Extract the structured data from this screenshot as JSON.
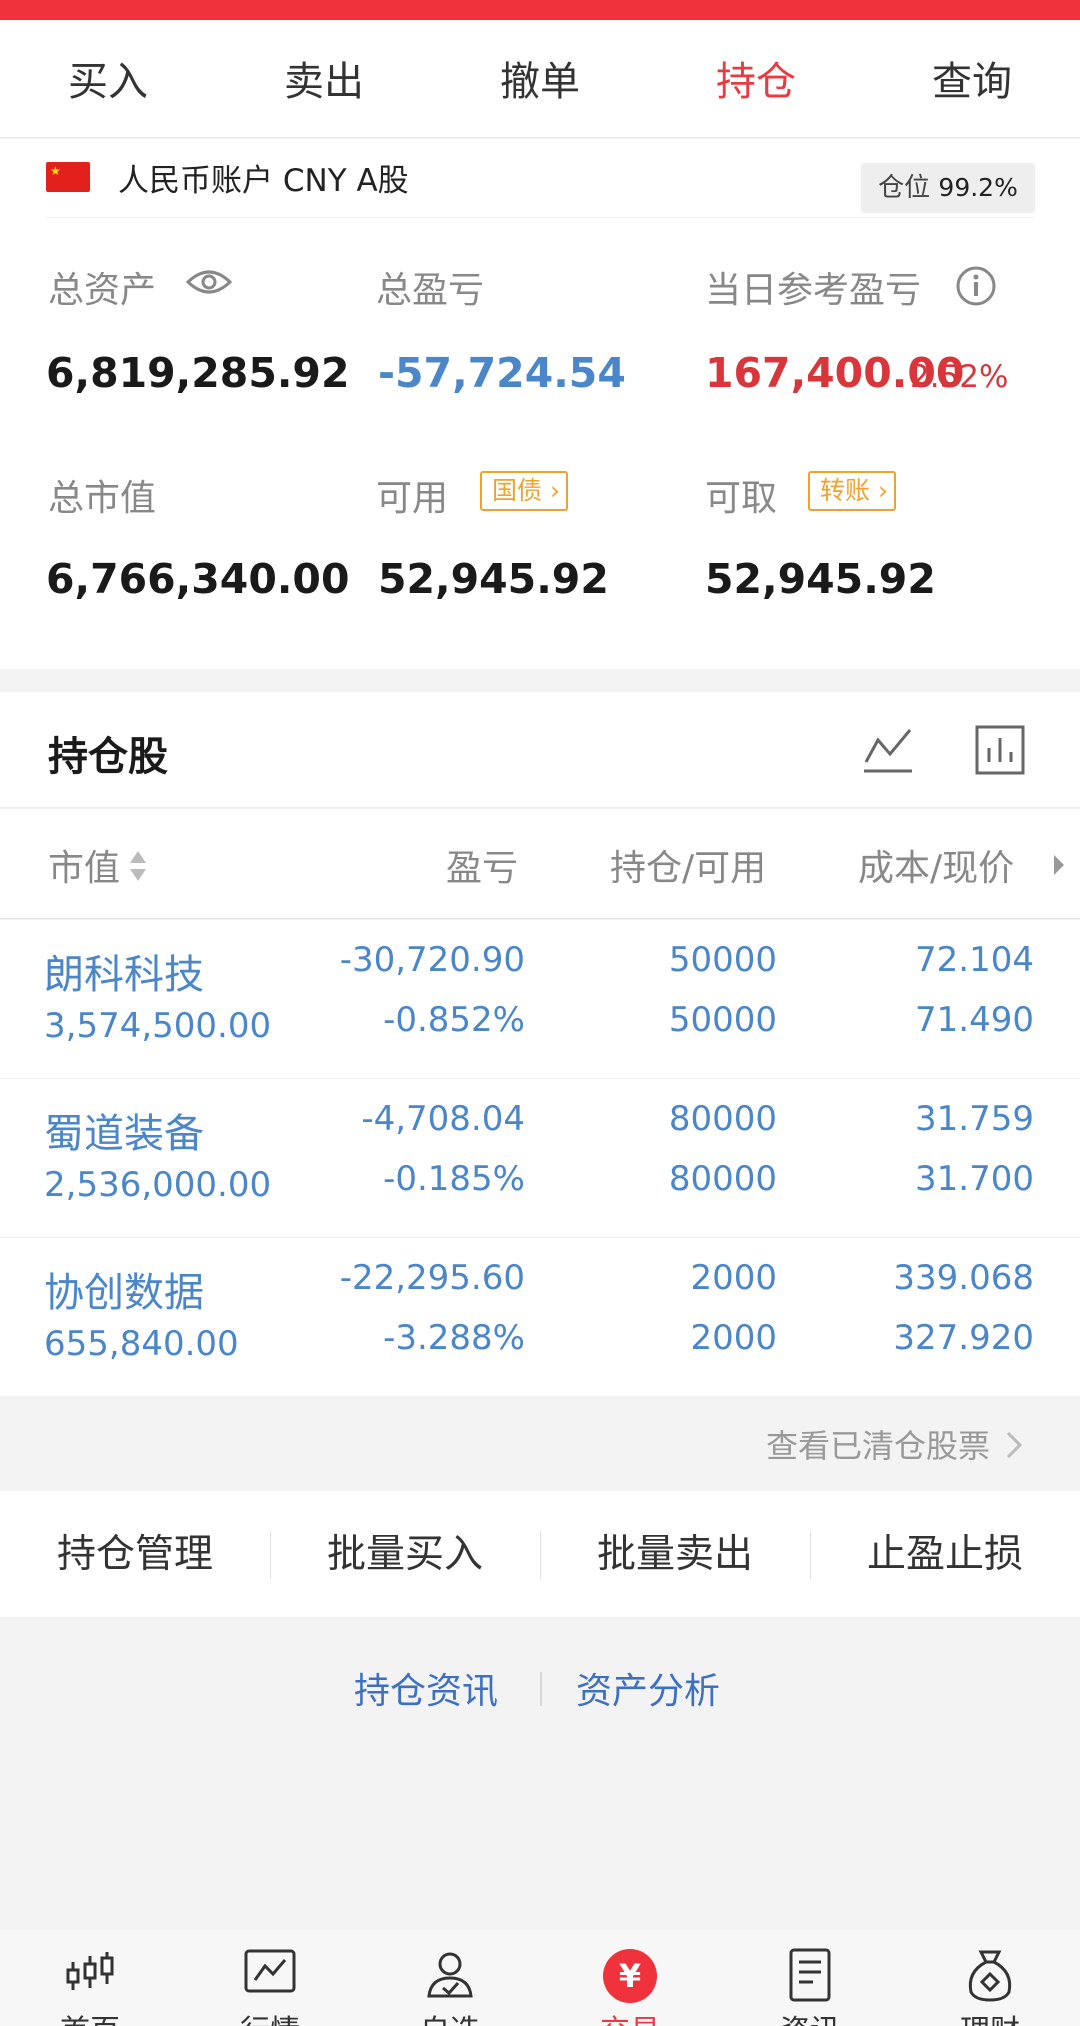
{
  "tabs": [
    {
      "label": "买入",
      "active": false
    },
    {
      "label": "卖出",
      "active": false
    },
    {
      "label": "撤单",
      "active": false
    },
    {
      "label": "持仓",
      "active": true
    },
    {
      "label": "查询",
      "active": false
    }
  ],
  "account": {
    "name": "人民币账户 CNY A股",
    "position_label": "仓位",
    "position_value": "99.2%"
  },
  "metrics": {
    "total_assets_label": "总资产",
    "total_assets": "6,819,285.92",
    "total_pnl_label": "总盈亏",
    "total_pnl": "-57,724.54",
    "day_pnl_label": "当日参考盈亏",
    "day_pnl": "167,400.00",
    "day_pnl_pct": "2.52%",
    "market_value_label": "总市值",
    "market_value": "6,766,340.00",
    "available_label": "可用",
    "available_tag": "国债",
    "available": "52,945.92",
    "withdrawable_label": "可取",
    "withdrawable_tag": "转账",
    "withdrawable": "52,945.92"
  },
  "holdings": {
    "title": "持仓股",
    "columns": [
      "市值",
      "盈亏",
      "持仓/可用",
      "成本/现价"
    ],
    "rows": [
      {
        "name": "朗科科技",
        "market_value": "3,574,500.00",
        "pnl": "-30,720.90",
        "pnl_pct": "-0.852%",
        "position": "50000",
        "available": "50000",
        "cost": "72.104",
        "price": "71.490"
      },
      {
        "name": "蜀道装备",
        "market_value": "2,536,000.00",
        "pnl": "-4,708.04",
        "pnl_pct": "-0.185%",
        "position": "80000",
        "available": "80000",
        "cost": "31.759",
        "price": "31.700"
      },
      {
        "name": "协创数据",
        "market_value": "655,840.00",
        "pnl": "-22,295.60",
        "pnl_pct": "-3.288%",
        "position": "2000",
        "available": "2000",
        "cost": "339.068",
        "price": "327.920"
      }
    ],
    "cleared_link": "查看已清仓股票"
  },
  "actions": [
    "持仓管理",
    "批量买入",
    "批量卖出",
    "止盈止损"
  ],
  "links": [
    "持仓资讯",
    "资产分析"
  ],
  "bottom_nav": [
    {
      "label": "首页",
      "icon": "candlestick-icon",
      "active": false
    },
    {
      "label": "行情",
      "icon": "market-chart-icon",
      "active": false
    },
    {
      "label": "自选",
      "icon": "person-check-icon",
      "active": false
    },
    {
      "label": "交易",
      "icon": "yen-icon",
      "active": true
    },
    {
      "label": "资讯",
      "icon": "document-icon",
      "active": false
    },
    {
      "label": "理财",
      "icon": "money-bag-icon",
      "active": false
    }
  ],
  "colors": {
    "accent_red": "#e93a40",
    "loss_blue": "#4a86c8",
    "tag_orange": "#f0a22e",
    "link_blue": "#3d6fc2"
  }
}
